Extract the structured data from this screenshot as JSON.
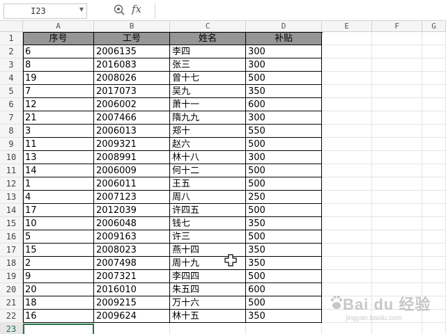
{
  "name_box": {
    "value": "I23"
  },
  "formula_bar": {
    "fx_label": "fx",
    "zoom_icon": "magnifier-icon",
    "value": ""
  },
  "columns": [
    "A",
    "B",
    "C",
    "D",
    "E",
    "F",
    "G"
  ],
  "rows": [
    "1",
    "2",
    "3",
    "4",
    "5",
    "6",
    "7",
    "8",
    "9",
    "10",
    "11",
    "12",
    "13",
    "14",
    "15",
    "16",
    "17",
    "18",
    "19",
    "20",
    "21",
    "22",
    "23"
  ],
  "table": {
    "headers": [
      "序号",
      "工号",
      "姓名",
      "补贴"
    ],
    "data": [
      [
        "6",
        "2006135",
        "李四",
        "300"
      ],
      [
        "8",
        "2016083",
        "张三",
        "300"
      ],
      [
        "19",
        "2008026",
        "曾十七",
        "500"
      ],
      [
        "7",
        "2017073",
        "吴九",
        "350"
      ],
      [
        "12",
        "2006002",
        "萧十一",
        "600"
      ],
      [
        "21",
        "2007466",
        "隋九九",
        "300"
      ],
      [
        "3",
        "2006013",
        "郑十",
        "550"
      ],
      [
        "11",
        "2009321",
        "赵六",
        "500"
      ],
      [
        "13",
        "2008991",
        "林十八",
        "300"
      ],
      [
        "14",
        "2006009",
        "何十二",
        "500"
      ],
      [
        "1",
        "2006011",
        "王五",
        "500"
      ],
      [
        "4",
        "2007123",
        "周八",
        "250"
      ],
      [
        "17",
        "2012039",
        "许四五",
        "500"
      ],
      [
        "10",
        "2006048",
        "钱七",
        "350"
      ],
      [
        "5",
        "2009163",
        "许三",
        "500"
      ],
      [
        "15",
        "2008023",
        "燕十四",
        "350"
      ],
      [
        "2",
        "2007498",
        "周十九",
        "350"
      ],
      [
        "9",
        "2007321",
        "李四四",
        "500"
      ],
      [
        "20",
        "2016010",
        "朱五四",
        "600"
      ],
      [
        "18",
        "2009215",
        "万十六",
        "500"
      ],
      [
        "16",
        "2009624",
        "林十五",
        "350"
      ]
    ]
  },
  "header_fill_color": "#969696",
  "active_color": "#217346",
  "watermark": {
    "brand": "Bai du 经验",
    "sub": "jingyan.baidu.com"
  },
  "cursor_icon": "move-crosshair-icon"
}
